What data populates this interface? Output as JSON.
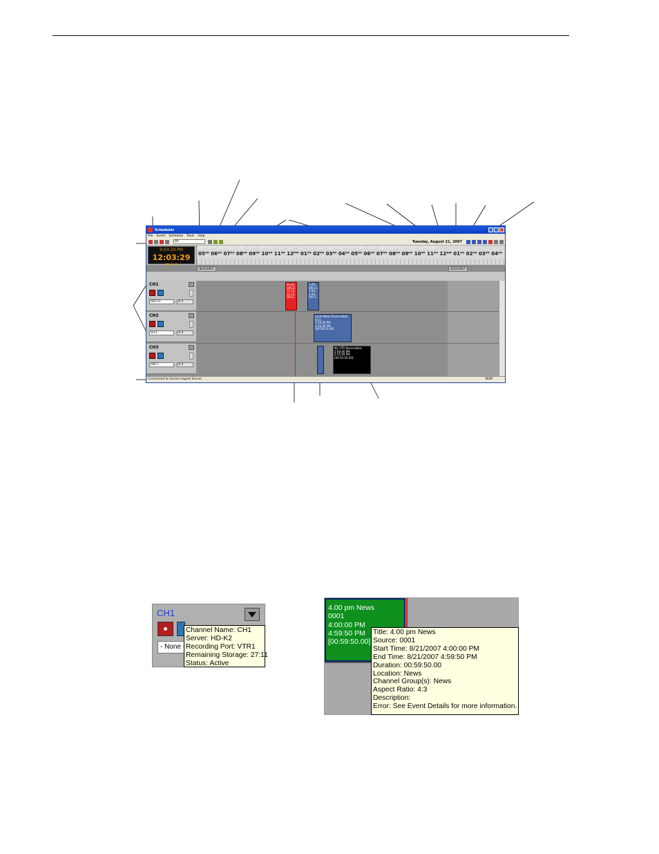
{
  "app": {
    "window_title": "Scheduler",
    "menu": [
      "File",
      "Event",
      "Schedule",
      "Tools",
      "Help"
    ],
    "filter_value": "All",
    "date_label": "Tuesday, August 21, 2007",
    "clock_small": "9:03:29 PM",
    "clock_big": "12:03:29 PM",
    "timeline_dim": "02⁰⁰  03⁰⁰  04⁰⁰  05⁰⁰  06⁰⁰  07⁰⁰  08⁰⁰  09⁰⁰  10⁰⁰  11⁰⁰  12ᴾᴹ  01⁰⁰  02⁰⁰  03⁰⁰  04⁰⁰  05⁰⁰  06⁰⁰  07⁰⁰  08⁰⁰  09⁰⁰  10⁰⁰  11⁰⁰  12ᴬᴹ  01⁰⁰",
    "timeline_main": "05⁰⁰  06⁰⁰  07⁰⁰  08⁰⁰  09⁰⁰  10⁰⁰  11⁰⁰  12ᴾᴹ  01⁰⁰  02⁰⁰  03⁰⁰  04⁰⁰  05⁰⁰  06⁰⁰  07⁰⁰  08⁰⁰  09⁰⁰  10⁰⁰  11⁰⁰  12ᴬᴹ  01⁰⁰  02⁰⁰  03⁰⁰  04⁰⁰",
    "date_tag_left": "8/21/2007",
    "date_tag_right": "8/22/2007",
    "channels": [
      {
        "name": "CH1",
        "source": "SRC11",
        "aspect": "4:3"
      },
      {
        "name": "CH2",
        "source": "Src1",
        "aspect": "4:3"
      },
      {
        "name": "CH3",
        "source": "SRC7",
        "aspect": "4:3"
      }
    ],
    "events": {
      "red": "Break..\nSRC11\n11:12...\n12:12...\n[00:5...",
      "blue1": "1:09...\nSRC11\n1:09...\n1:59...\n[00:5...",
      "blue2": "Local News Reservation\nSrc1\n3:30:00 PM\n4:30:00 PM\n[00:59:50.00]",
      "black": "My VTR Reservation\n2:00:00 PM\n2:55:50 PM\n[00:55:50.00]"
    },
    "status_left": "Connected to Aurora Ingest Server",
    "status_right": "NUM"
  },
  "inset_channel": {
    "channel_label": "CH1",
    "source_value": "- None -",
    "tooltip_lines": [
      "Channel Name: CH1",
      "Server: HD-K2",
      "Recording Port: VTR1",
      "Remaining Storage: 27:11",
      "Status: Active"
    ]
  },
  "inset_event": {
    "event_lines": [
      "4.00 pm News",
      "0001",
      "4:00:00 PM",
      "4:59:50 PM",
      "[00:59:50.00]"
    ],
    "tooltip_lines": [
      "Title: 4.00 pm News",
      "Source: 0001",
      "Start Time: 8/21/2007 4:00:00 PM",
      "End Time: 8/21/2007 4:59:50 PM",
      "Duration: 00:59:50.00",
      "Location: News",
      "Channel Group(s): News",
      "Aspect Ratio: 4:3",
      "Description:",
      "Error: See Event Details for more information."
    ]
  }
}
